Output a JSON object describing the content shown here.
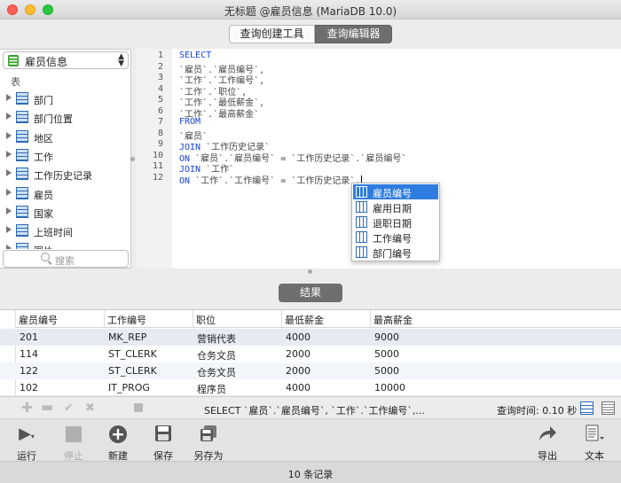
{
  "window": {
    "title": "无标题 @雇员信息 (MariaDB 10.0)"
  },
  "tabs": [
    {
      "label": "查询创建工具",
      "active": false
    },
    {
      "label": "查询编辑器",
      "active": true
    }
  ],
  "sidebar": {
    "database": "雇员信息",
    "section_label": "表",
    "tables": [
      "部门",
      "部门位置",
      "地区",
      "工作",
      "工作历史记录",
      "雇员",
      "国家",
      "上班时间",
      "图片"
    ],
    "search_placeholder": "搜索"
  },
  "editor": {
    "line_numbers": [
      "1",
      "2",
      "3",
      "4",
      "5",
      "6",
      "7",
      "8",
      "9",
      "10",
      "11",
      "12"
    ],
    "lines": [
      {
        "kw": "SELECT",
        "rest": ""
      },
      {
        "kw": "",
        "rest": "`雇员`.`雇员编号`,"
      },
      {
        "kw": "",
        "rest": "`工作`.`工作编号`,"
      },
      {
        "kw": "",
        "rest": "`工作`.`职位`,"
      },
      {
        "kw": "",
        "rest": "`工作`.`最低薪金`,"
      },
      {
        "kw": "",
        "rest": "`工作`.`最高薪金`"
      },
      {
        "kw": "FROM",
        "rest": ""
      },
      {
        "kw": "",
        "rest": "`雇员`"
      },
      {
        "kw": "JOIN",
        "rest": " `工作历史记录`"
      },
      {
        "kw": "ON",
        "rest": " `雇员`.`雇员编号` = `工作历史记录`.`雇员编号`"
      },
      {
        "kw": "JOIN",
        "rest": " `工作`"
      },
      {
        "kw": "ON",
        "rest": " `工作`.`工作编号` = `工作历史记录`."
      }
    ]
  },
  "autocomplete": {
    "items": [
      "雇员编号",
      "雇用日期",
      "退职日期",
      "工作编号",
      "部门编号"
    ],
    "selected_index": 0
  },
  "results": {
    "button_label": "结果",
    "columns": [
      "雇员编号",
      "工作编号",
      "职位",
      "最低薪金",
      "最高薪金"
    ],
    "rows": [
      [
        "201",
        "MK_REP",
        "营销代表",
        "4000",
        "9000"
      ],
      [
        "114",
        "ST_CLERK",
        "仓务文员",
        "2000",
        "5000"
      ],
      [
        "122",
        "ST_CLERK",
        "仓务文员",
        "2000",
        "5000"
      ],
      [
        "102",
        "IT_PROG",
        "程序员",
        "4000",
        "10000"
      ]
    ]
  },
  "status": {
    "sql_preview": "SELECT `雇员`.`雇员编号`, `工作`.`工作编号`,...",
    "query_time": "查询时间: 0.10 秒"
  },
  "toolbar": {
    "run": "运行",
    "stop": "停止",
    "new": "新建",
    "save": "保存",
    "save_as": "另存为",
    "export": "导出",
    "text": "文本"
  },
  "footer": {
    "record_count": "10 条记录"
  },
  "colors": {
    "keyword": "#1843d8",
    "selection": "#2f7ce0",
    "segment_active": "#6e6e6e"
  }
}
